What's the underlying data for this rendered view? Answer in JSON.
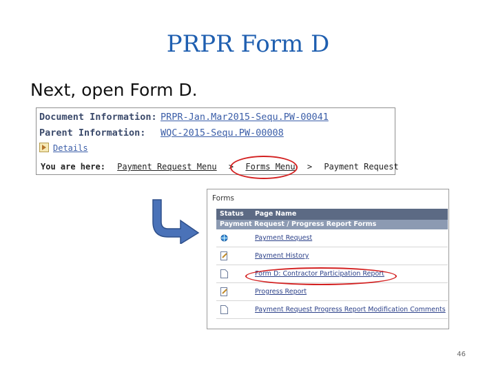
{
  "slide": {
    "title": "PRPR Form D",
    "subtitle": "Next, open Form D.",
    "page_number": "46"
  },
  "doc_panel": {
    "document_label": "Document Information:",
    "document_value": "PRPR-Jan.Mar2015-Sequ.PW-00041",
    "parent_label": "Parent Information:",
    "parent_value": "WQC-2015-Sequ.PW-00008",
    "details_label": "Details",
    "you_are_here": "You are here:",
    "breadcrumbs": [
      "Payment Request Menu",
      "Forms Menu",
      "Payment Request"
    ],
    "separator": ">"
  },
  "forms_panel": {
    "title": "Forms",
    "columns": [
      "Status",
      "Page Name"
    ],
    "group_label": "Payment Request / Progress Report Forms",
    "rows": [
      {
        "icon": "globe-icon",
        "label": "Payment Request"
      },
      {
        "icon": "edit-document-icon",
        "label": "Payment History"
      },
      {
        "icon": "document-icon",
        "label": "Form D: Contractor Participation Report"
      },
      {
        "icon": "edit-document-icon",
        "label": "Progress Report"
      },
      {
        "icon": "document-icon",
        "label": "Payment Request Progress Report Modification Comments"
      }
    ]
  },
  "colors": {
    "title": "#1f5fb0",
    "highlight_oval": "#d32020",
    "arrow": "#4a72b8",
    "table_header": "#5c6a84",
    "group_header": "#8c9ab2"
  }
}
